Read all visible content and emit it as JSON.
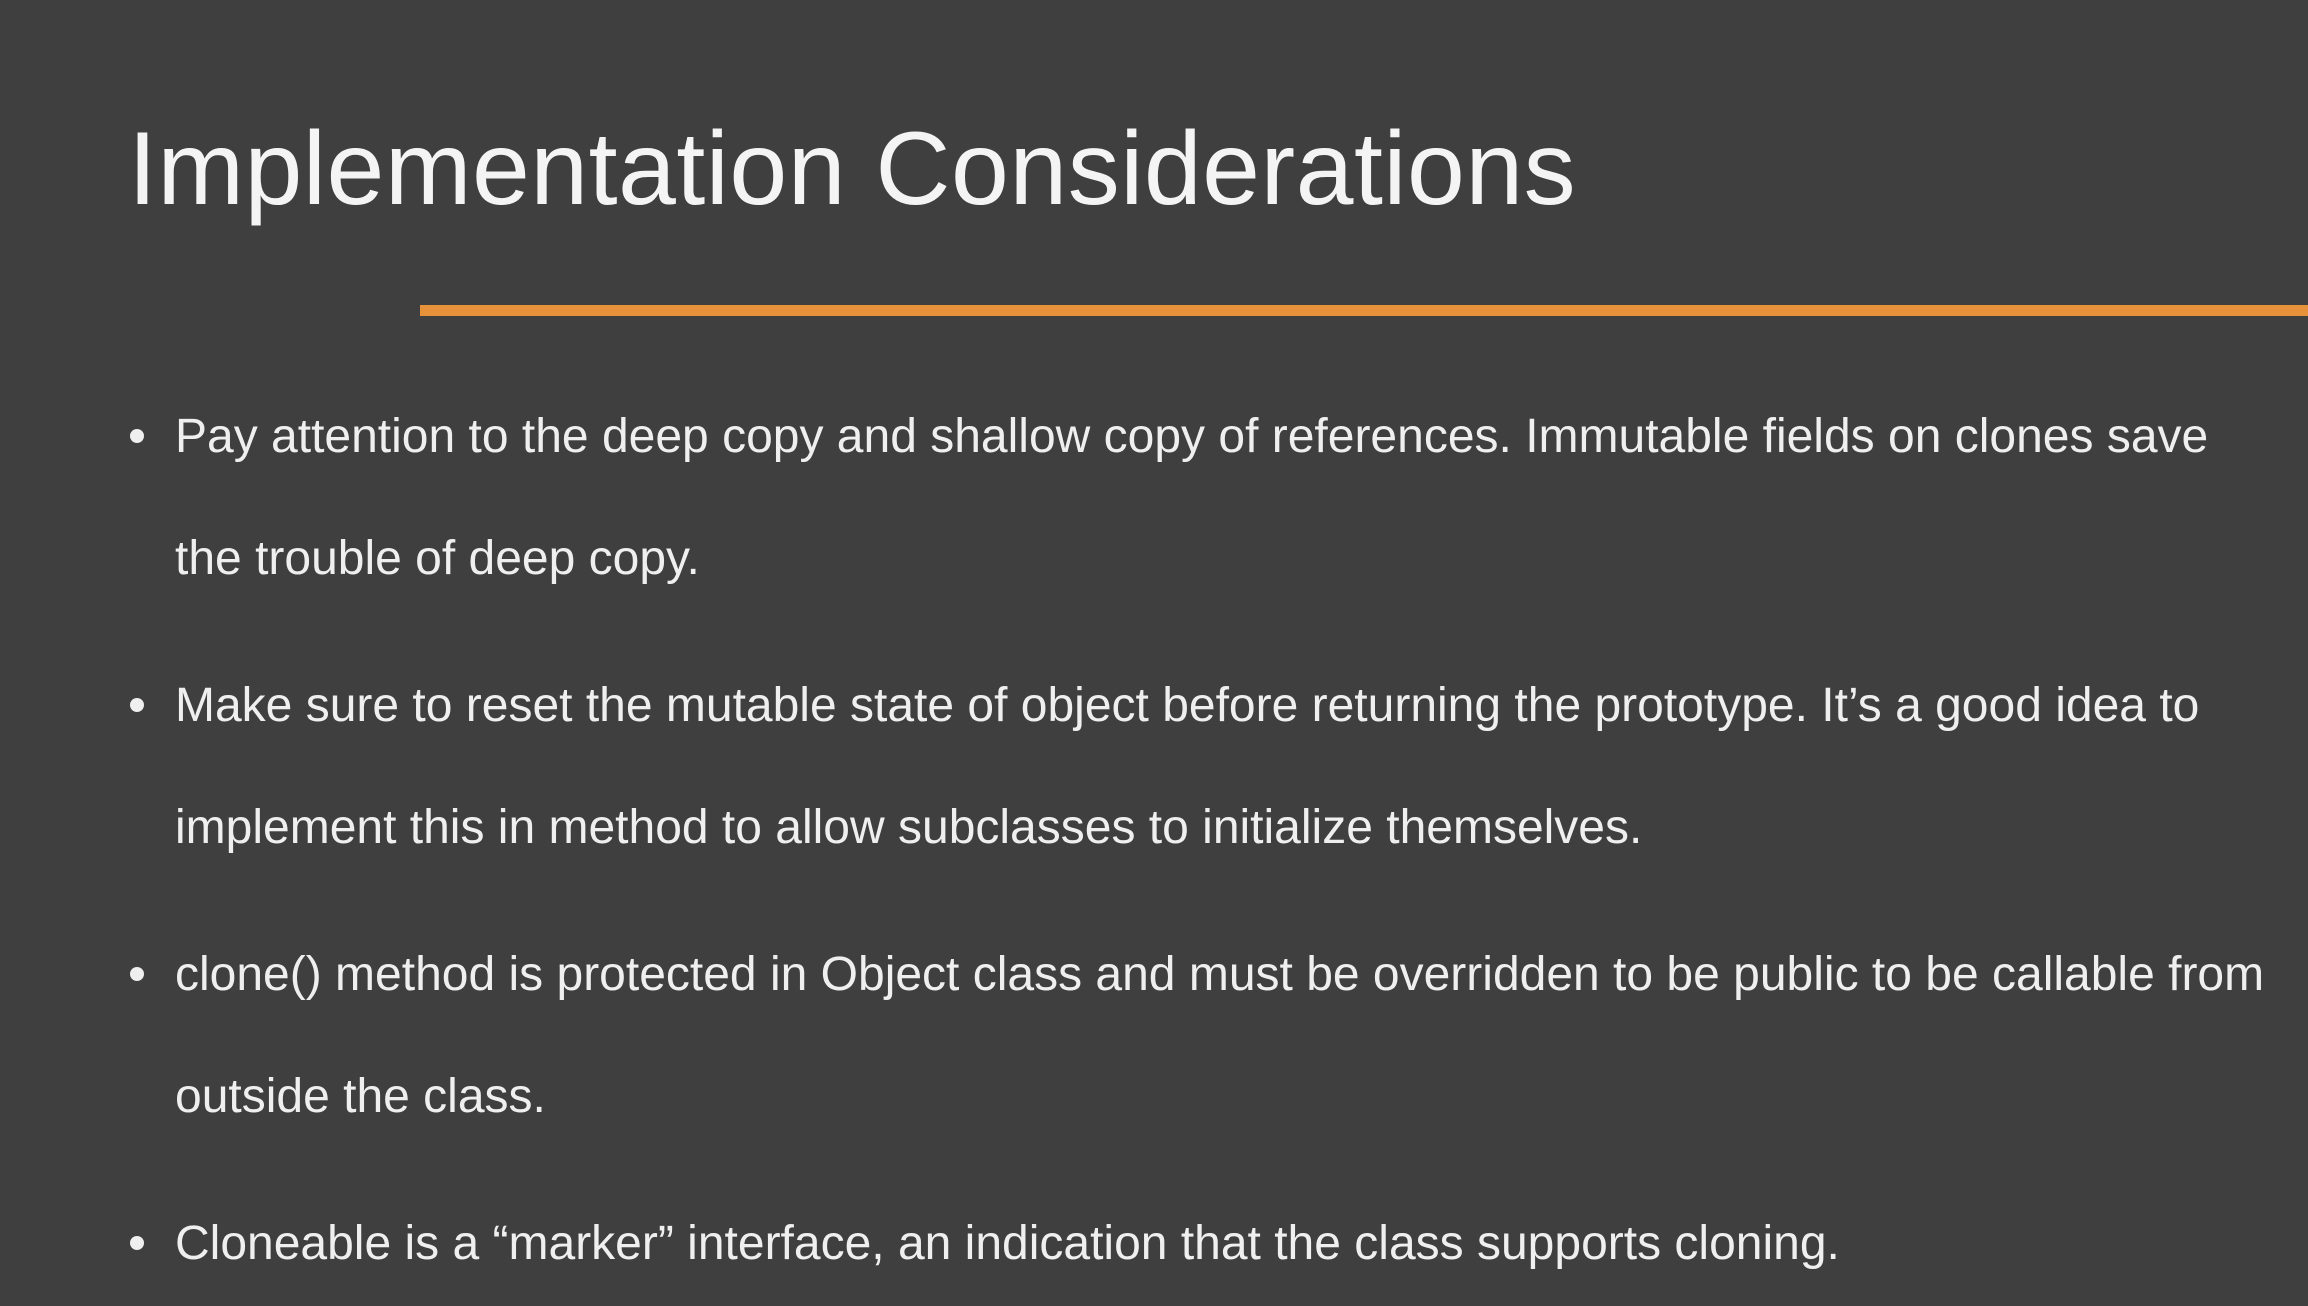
{
  "slide": {
    "title": "Implementation Considerations",
    "accent_color": "#e7923a",
    "background_color": "#3f3f3f",
    "bullets": [
      "Pay attention to the deep copy and shallow copy of references. Immutable fields on clones save the trouble of deep copy.",
      "Make sure to reset the mutable state of object before returning the prototype. It’s a good idea to implement this in method to allow subclasses to initialize themselves.",
      "clone() method is protected in Object class and must be overridden to be public to be callable from outside the class.",
      "Cloneable is a “marker” interface, an indication that the class supports cloning."
    ]
  }
}
